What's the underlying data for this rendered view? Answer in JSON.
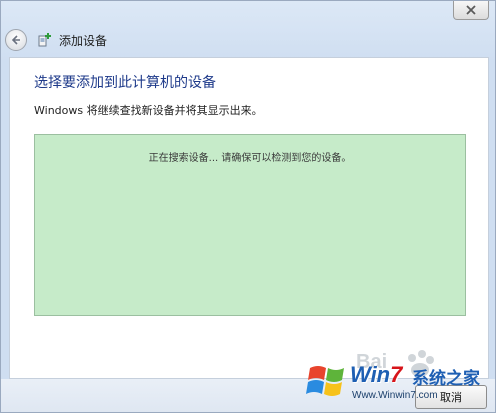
{
  "window": {
    "title": "添加设备"
  },
  "content": {
    "heading": "选择要添加到此计算机的设备",
    "subtext": "Windows 将继续查找新设备并将其显示出来。",
    "searching_text": "正在搜索设备... 请确保可以检测到您的设备。"
  },
  "footer": {
    "cancel_label": "取消"
  },
  "watermark": {
    "brand": "Baidu",
    "title_prefix": "Win",
    "title_seven": "7",
    "cn_text": "系统之家",
    "url": "Www.Winwin7.com"
  },
  "colors": {
    "heading": "#1e3a8a",
    "device_area_bg": "#c6ebc9",
    "window_chrome": "#cfdef1"
  },
  "icons": {
    "close": "close-icon",
    "back": "back-arrow-icon",
    "title": "add-device-icon"
  }
}
